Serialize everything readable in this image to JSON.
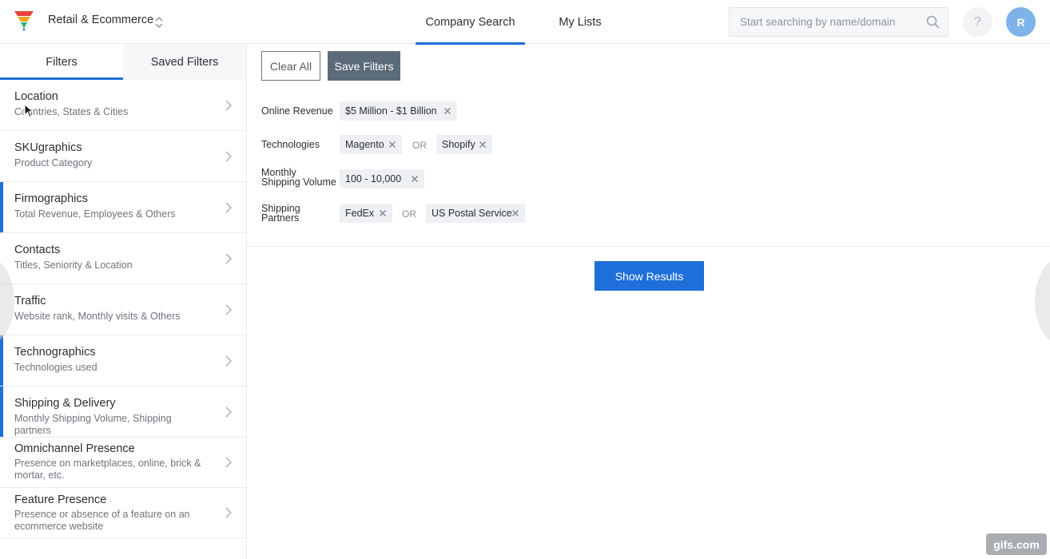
{
  "header": {
    "workspace": "Retail & Ecommerce",
    "tabs": [
      {
        "label": "Company Search",
        "active": true
      },
      {
        "label": "My Lists",
        "active": false
      }
    ],
    "search_placeholder": "Start searching by name/domain",
    "help_label": "?",
    "avatar_initial": "R",
    "accent_color": "#1e6fd9",
    "icons": [
      "funnel-logo-icon",
      "updown-chevron-icon",
      "search-icon"
    ]
  },
  "sidebar": {
    "tabs": [
      {
        "label": "Filters",
        "active": true
      },
      {
        "label": "Saved Filters",
        "active": false
      }
    ],
    "items": [
      {
        "title": "Location",
        "subtitle": "Countries, States & Cities",
        "selected": false
      },
      {
        "title": "SKUgraphics",
        "subtitle": "Product Category",
        "selected": false
      },
      {
        "title": "Firmographics",
        "subtitle": "Total Revenue, Employees & Others",
        "selected": true
      },
      {
        "title": "Contacts",
        "subtitle": "Titles, Seniority & Location",
        "selected": false
      },
      {
        "title": "Traffic",
        "subtitle": "Website rank, Monthly visits & Others",
        "selected": false
      },
      {
        "title": "Technographics",
        "subtitle": "Technologies used",
        "selected": true
      },
      {
        "title": "Shipping & Delivery",
        "subtitle": "Monthly Shipping Volume, Shipping partners",
        "selected": true
      },
      {
        "title": "Omnichannel Presence",
        "subtitle": "Presence on marketplaces, online, brick & mortar, etc.",
        "selected": false
      },
      {
        "title": "Feature Presence",
        "subtitle": "Presence or absence of a feature on an ecommerce website",
        "selected": false
      }
    ]
  },
  "actions": {
    "clear_all": "Clear All",
    "save_filters": "Save Filters",
    "show_results": "Show Results"
  },
  "filters": [
    {
      "label": "Online Revenue",
      "values": [
        "$5 Million - $1 Billion"
      ]
    },
    {
      "label": "Technologies",
      "values": [
        "Magento",
        "Shopify"
      ],
      "joiner": "OR"
    },
    {
      "label": "Monthly Shipping Volume",
      "values": [
        "100 - 10,000"
      ]
    },
    {
      "label": "Shipping Partners",
      "values": [
        "FedEx",
        "US Postal Service"
      ],
      "joiner": "OR"
    }
  ],
  "watermark": "gifs.com"
}
